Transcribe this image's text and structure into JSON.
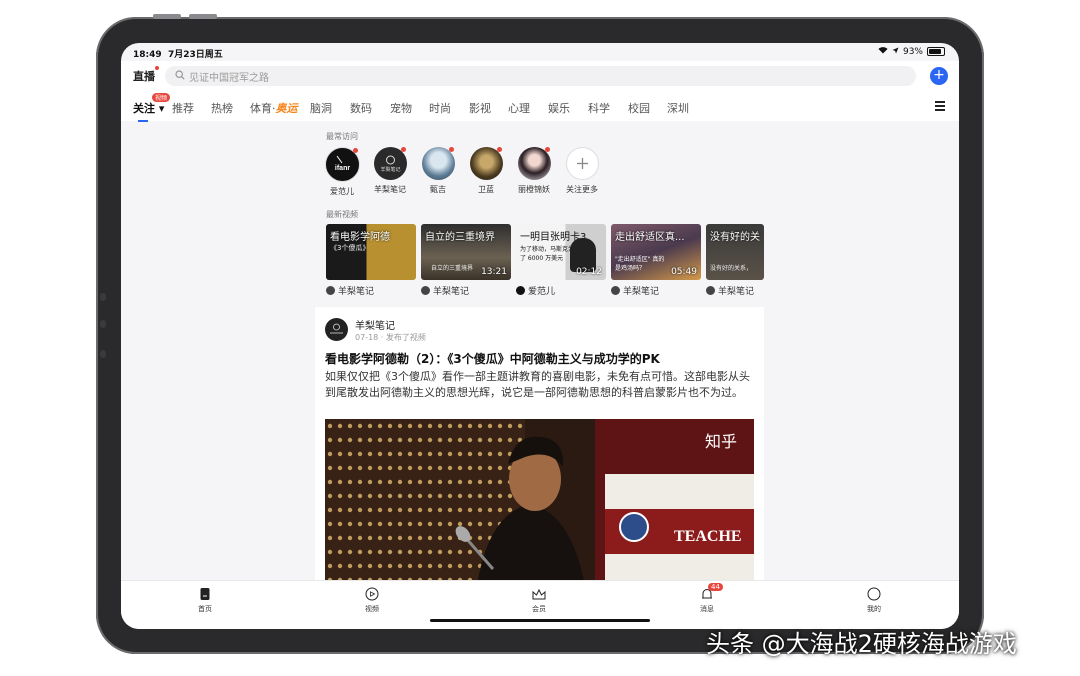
{
  "status_bar": {
    "time": "18:49",
    "date": "7月23日周五",
    "battery": "93%"
  },
  "header": {
    "live_label": "直播",
    "search_placeholder": "见证中国冠军之路"
  },
  "tabs": [
    "关注",
    "推荐",
    "热榜",
    "体育·",
    "脑洞",
    "数码",
    "宠物",
    "时尚",
    "影视",
    "心理",
    "娱乐",
    "科学",
    "校园",
    "深圳"
  ],
  "tabs_extra": {
    "sports_tag": "奥运",
    "follow_badge": "视频"
  },
  "frequent": {
    "label": "最常访问",
    "items": [
      {
        "name": "爱范儿",
        "logo_text": "ifanr"
      },
      {
        "name": "羊梨笔记",
        "logo_text": "羊梨笔记"
      },
      {
        "name": "甄吉"
      },
      {
        "name": "卫蓝"
      },
      {
        "name": "丽橙锦妖"
      },
      {
        "name": "关注更多"
      }
    ]
  },
  "latest_videos": {
    "label": "最新视频",
    "items": [
      {
        "title": "看电影学阿德",
        "subtitle": "《3个傻瓜》",
        "duration": "",
        "source": "羊梨笔记"
      },
      {
        "title": "自立的三重境界",
        "subtitle": "自立的三重境界",
        "duration": "13:21",
        "source": "羊梨笔记"
      },
      {
        "title": "一明目张明卡3",
        "subtitle": "为了移动，马斯克为了 6000 万美元",
        "duration": "02:12",
        "source": "爱范儿"
      },
      {
        "title": "走出舒适区真...",
        "subtitle": "\"走出舒适区\" 真的是鸡汤吗？",
        "duration": "05:49",
        "source": "羊梨笔记"
      },
      {
        "title": "没有好的关",
        "subtitle": "没有好的关系，",
        "duration": "",
        "source": "羊梨笔记"
      }
    ]
  },
  "post": {
    "author": "羊梨笔记",
    "meta": "07-18 · 发布了视频",
    "title": "看电影学阿德勒（2）：《3个傻瓜》中阿德勒主义与成功学的PK",
    "description": "如果仅仅把《3个傻瓜》看作一部主题讲教育的喜剧电影，未免有点可惜。这部电影从头到尾散发出阿德勒主义的思想光辉，说它是一部阿德勒思想的科普启蒙影片也不为过。",
    "image_watermark": "知乎",
    "image_sign": "TEACHE"
  },
  "bottom_nav": {
    "items": [
      {
        "label": "首页",
        "icon": "home-icon"
      },
      {
        "label": "视频",
        "icon": "video-icon"
      },
      {
        "label": "会员",
        "icon": "crown-icon"
      },
      {
        "label": "消息",
        "icon": "bell-icon",
        "badge": "44"
      },
      {
        "label": "我的",
        "icon": "profile-icon"
      }
    ]
  },
  "overlay_watermark": "头条 @大海战2硬核海战游戏",
  "colors": {
    "accent": "#2b66f2",
    "badge": "#e8453c",
    "sports": "#f6871f"
  }
}
